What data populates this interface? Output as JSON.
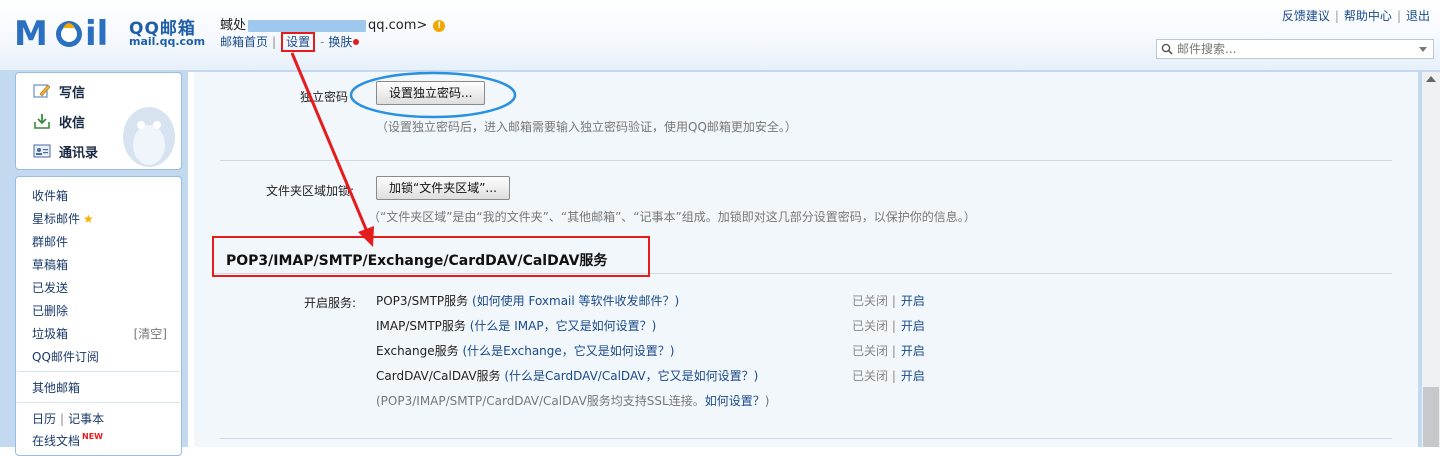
{
  "brand": {
    "logo_text": "MOil",
    "name_cn": "QQ邮箱",
    "url": "mail.qq.com"
  },
  "account": {
    "name_prefix": "蜮处",
    "email_suffix": "qq.com>"
  },
  "topnav": {
    "home": "邮箱首页",
    "settings": "设置",
    "dash": "-",
    "skin": "换肤",
    "sep": "|"
  },
  "toplinks": {
    "feedback": "反馈建议",
    "help": "帮助中心",
    "logout": "退出",
    "sep": "|"
  },
  "search": {
    "placeholder": "邮件搜索..."
  },
  "sidebar": {
    "compose": "写信",
    "inbox_check": "收信",
    "contacts": "通讯录",
    "folders": {
      "inbox": "收件箱",
      "starred": "星标邮件",
      "star_glyph": "★",
      "group": "群邮件",
      "drafts": "草稿箱",
      "sent": "已发送",
      "deleted": "已删除",
      "spam": "垃圾箱",
      "spam_clear": "[清空]",
      "subscriptions": "QQ邮件订阅",
      "other": "其他邮箱",
      "calendar": "日历",
      "notes": "记事本",
      "cal_sep": "|",
      "docs": "在线文档",
      "docs_badge": "NEW"
    }
  },
  "settings": {
    "independent_password": {
      "label": "独立密码",
      "button": "设置独立密码...",
      "hint": "（设置独立密码后，进入邮箱需要输入独立密码验证，使用QQ邮箱更加安全。）"
    },
    "folder_lock": {
      "label": "文件夹区域加锁:",
      "button": "加锁“文件夹区域”...",
      "hint": "（“文件夹区域”是由“我的文件夹”、“其他邮箱”、“记事本”组成。加锁即对这几部分设置密码，以保护你的信息。）"
    },
    "services": {
      "title": "POP3/IMAP/SMTP/Exchange/CardDAV/CalDAV服务",
      "enable_label": "开启服务:",
      "items": [
        {
          "name": "POP3/SMTP服务",
          "help": "(如何使用 Foxmail 等软件收发邮件？)",
          "status": "已关闭",
          "sep": "|",
          "action": "开启"
        },
        {
          "name": "IMAP/SMTP服务",
          "help": "(什么是 IMAP，它又是如何设置？)",
          "status": "已关闭",
          "sep": "|",
          "action": "开启"
        },
        {
          "name": "Exchange服务",
          "help": "(什么是Exchange，它又是如何设置？)",
          "status": "已关闭",
          "sep": "|",
          "action": "开启"
        },
        {
          "name": "CardDAV/CalDAV服务",
          "help": "(什么是CardDAV/CalDAV，它又是如何设置？)",
          "status": "已关闭",
          "sep": "|",
          "action": "开启"
        }
      ],
      "ssl_note": "(POP3/IMAP/SMTP/CardDAV/CalDAV服务均支持SSL连接。",
      "ssl_link": "如何设置？",
      "ssl_close": ")"
    }
  },
  "colors": {
    "accent": "#1a4a8a",
    "annotation_red": "#e51c1c",
    "annotation_blue": "#2a90e0",
    "frame": "#c3d9f0"
  }
}
